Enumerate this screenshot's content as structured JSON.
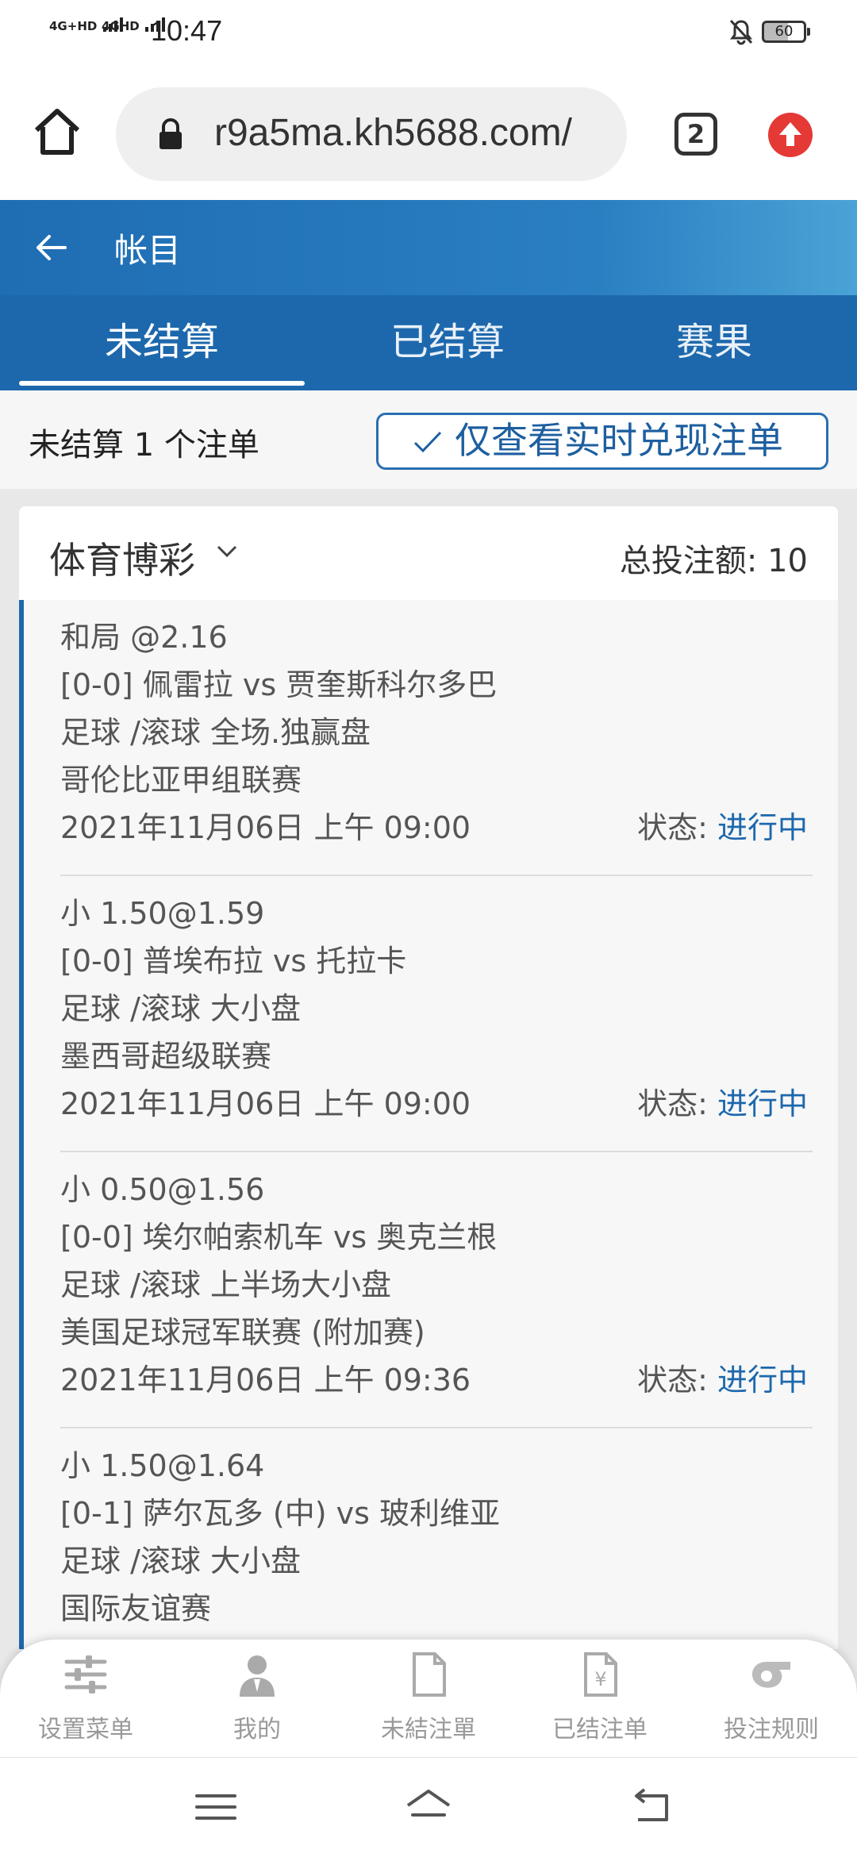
{
  "status_bar": {
    "signal1_label": "4G+HD",
    "signal2_label": "4GHD",
    "time": "10:47",
    "battery": "60"
  },
  "browser": {
    "url": "r9a5ma.kh5688.com/",
    "tab_count": "2"
  },
  "header": {
    "title": "帐目"
  },
  "tabs": [
    {
      "label": "未结算",
      "active": true
    },
    {
      "label": "已结算",
      "active": false
    },
    {
      "label": "赛果",
      "active": false
    }
  ],
  "filter": {
    "count_text": "未结算 1 个注单",
    "realtime_button": "仅查看实时兑现注单"
  },
  "card": {
    "category": "体育博彩",
    "total_label": "总投注额: 10"
  },
  "bets": [
    {
      "selection": "和局 @2.16",
      "match": "[0-0] 佩雷拉 vs 贾奎斯科尔多巴",
      "market": "足球 /滚球 全场.独赢盘",
      "league": "哥伦比亚甲组联赛",
      "datetime": "2021年11月06日 上午 09:00",
      "status_label": "状态: ",
      "status_value": "进行中"
    },
    {
      "selection": "小 1.50@1.59",
      "match": "[0-0] 普埃布拉 vs 托拉卡",
      "market": "足球 /滚球 大小盘",
      "league": "墨西哥超级联赛",
      "datetime": "2021年11月06日 上午 09:00",
      "status_label": "状态: ",
      "status_value": "进行中"
    },
    {
      "selection": "小 0.50@1.56",
      "match": "[0-0] 埃尔帕索机车 vs 奥克兰根",
      "market": "足球 /滚球 上半场大小盘",
      "league": "美国足球冠军联赛 (附加赛)",
      "datetime": "2021年11月06日 上午 09:36",
      "status_label": "状态: ",
      "status_value": "进行中"
    },
    {
      "selection": "小 1.50@1.64",
      "match": "[0-1] 萨尔瓦多 (中) vs 玻利维亚",
      "market": "足球 /滚球 大小盘",
      "league": "国际友谊赛"
    }
  ],
  "bottom_nav": [
    {
      "label": "设置菜单",
      "icon": "sliders-icon"
    },
    {
      "label": "我的",
      "icon": "user-icon"
    },
    {
      "label": "未結注單",
      "icon": "document-icon"
    },
    {
      "label": "已结注单",
      "icon": "yen-document-icon"
    },
    {
      "label": "投注规则",
      "icon": "whistle-icon"
    }
  ],
  "colors": {
    "header_blue": "#1f6db3",
    "tab_blue": "#1d68ad",
    "status_blue": "#1d68ad",
    "upload_red": "#e53935"
  }
}
